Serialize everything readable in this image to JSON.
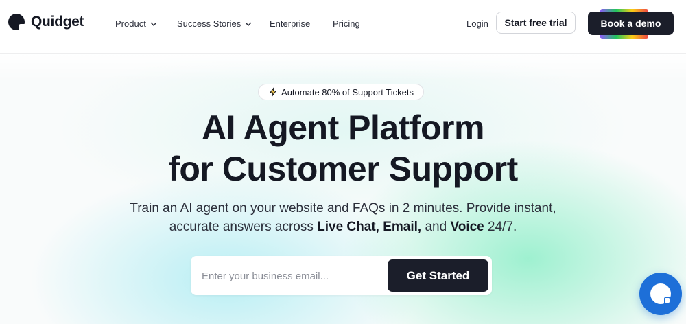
{
  "header": {
    "brand": "Quidget",
    "nav": [
      {
        "label": "Product",
        "has_dropdown": true
      },
      {
        "label": "Success Stories",
        "has_dropdown": true
      },
      {
        "label": "Enterprise",
        "has_dropdown": false
      },
      {
        "label": "Pricing",
        "has_dropdown": false
      }
    ],
    "login": "Login",
    "trial_button": "Start free trial",
    "demo_button": "Book a demo"
  },
  "hero": {
    "badge": {
      "icon": "lightning-bolt-icon",
      "text": "Automate 80% of Support Tickets"
    },
    "headline_line1": "AI Agent Platform",
    "headline_line2": "for Customer Support",
    "sub_line1": "Train an AI agent on your website and FAQs in 2 minutes. Provide instant,",
    "sub_line2": {
      "intro": "accurate answers across ",
      "chat": "Live Chat,",
      "email": "Email,",
      "and": " and ",
      "voice": "Voice",
      "tail": " 24/7."
    },
    "email_placeholder": "Enter your business email...",
    "cta": "Get Started"
  },
  "chat_widget": {
    "icon": "chat-bubble-icon"
  },
  "colors": {
    "ink": "#151823",
    "button_dark": "#1b1e2a",
    "chat_blue": "#1d6fd8",
    "hero_mint": "#78ecbe",
    "hero_cyan": "#96e8f0"
  }
}
